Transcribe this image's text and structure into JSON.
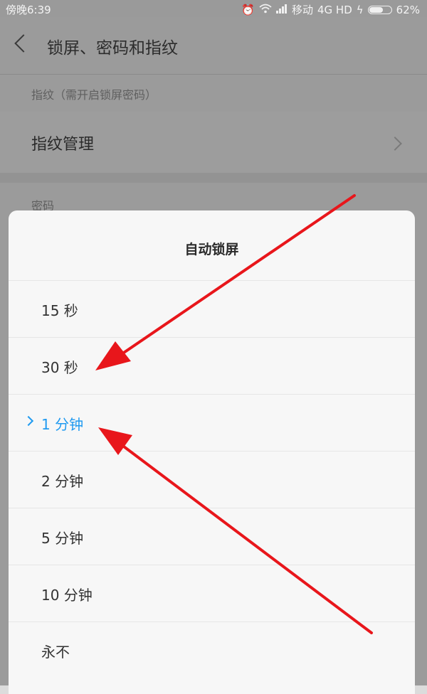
{
  "status_bar": {
    "time": "傍晚6:39",
    "carrier": "移动",
    "network": "4G HD",
    "battery": "62%",
    "battery_level": 0.62
  },
  "header": {
    "title": "锁屏、密码和指纹"
  },
  "settings": {
    "fingerprint_section": "指纹（需开启锁屏密码）",
    "fingerprint_manage": "指纹管理",
    "password_section": "密码"
  },
  "dialog": {
    "title": "自动锁屏",
    "options": [
      {
        "label": "15 秒",
        "selected": false
      },
      {
        "label": "30 秒",
        "selected": false
      },
      {
        "label": "1 分钟",
        "selected": true
      },
      {
        "label": "2 分钟",
        "selected": false
      },
      {
        "label": "5 分钟",
        "selected": false
      },
      {
        "label": "10 分钟",
        "selected": false
      },
      {
        "label": "永不",
        "selected": false
      }
    ]
  },
  "colors": {
    "accent": "#1f9af0",
    "annotation": "#e8161b"
  }
}
